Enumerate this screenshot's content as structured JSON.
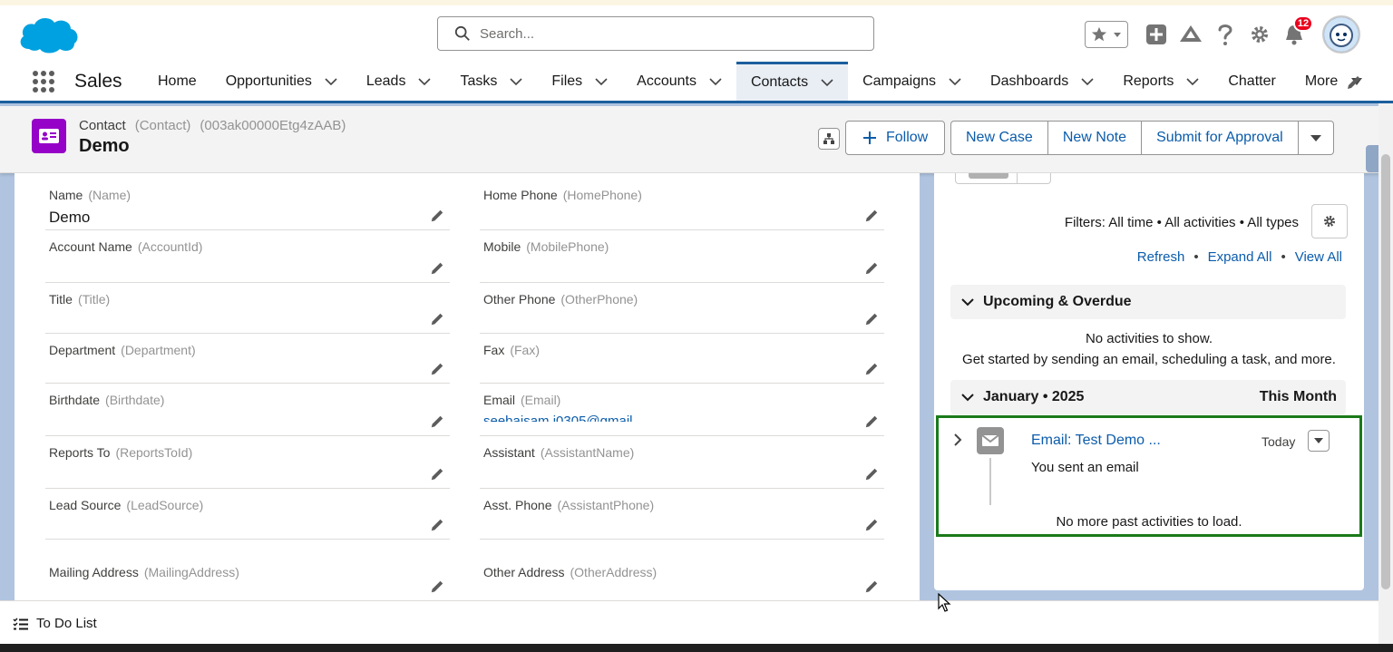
{
  "header": {
    "search_placeholder": "Search...",
    "notification_count": "12"
  },
  "nav": {
    "app_name": "Sales",
    "items": [
      {
        "label": "Home",
        "dropdown": false
      },
      {
        "label": "Opportunities",
        "dropdown": true
      },
      {
        "label": "Leads",
        "dropdown": true
      },
      {
        "label": "Tasks",
        "dropdown": true
      },
      {
        "label": "Files",
        "dropdown": true
      },
      {
        "label": "Accounts",
        "dropdown": true
      },
      {
        "label": "Contacts",
        "dropdown": true,
        "active": true
      },
      {
        "label": "Campaigns",
        "dropdown": true
      },
      {
        "label": "Dashboards",
        "dropdown": true
      },
      {
        "label": "Reports",
        "dropdown": true
      },
      {
        "label": "Chatter",
        "dropdown": false
      },
      {
        "label": "More",
        "dropdown": true
      }
    ]
  },
  "record": {
    "object_label": "Contact",
    "object_api": "(Contact)",
    "record_id": "(003ak00000Etg4zAAB)",
    "name": "Demo",
    "follow_label": "Follow",
    "actions": [
      "New Case",
      "New Note",
      "Submit for Approval"
    ]
  },
  "fields": {
    "left": [
      {
        "label": "Name",
        "api": "(Name)",
        "value": "Demo"
      },
      {
        "label": "Account Name",
        "api": "(AccountId)",
        "value": ""
      },
      {
        "label": "Title",
        "api": "(Title)",
        "value": ""
      },
      {
        "label": "Department",
        "api": "(Department)",
        "value": ""
      },
      {
        "label": "Birthdate",
        "api": "(Birthdate)",
        "value": ""
      },
      {
        "label": "Reports To",
        "api": "(ReportsToId)",
        "value": ""
      },
      {
        "label": "Lead Source",
        "api": "(LeadSource)",
        "value": ""
      },
      {
        "label": "Mailing Address",
        "api": "(MailingAddress)",
        "value": ""
      }
    ],
    "right": [
      {
        "label": "Home Phone",
        "api": "(HomePhone)",
        "value": ""
      },
      {
        "label": "Mobile",
        "api": "(MobilePhone)",
        "value": ""
      },
      {
        "label": "Other Phone",
        "api": "(OtherPhone)",
        "value": ""
      },
      {
        "label": "Fax",
        "api": "(Fax)",
        "value": ""
      },
      {
        "label": "Email",
        "api": "(Email)",
        "value": "seebaisam.i0305@gmail"
      },
      {
        "label": "Assistant",
        "api": "(AssistantName)",
        "value": ""
      },
      {
        "label": "Asst. Phone",
        "api": "(AssistantPhone)",
        "value": ""
      },
      {
        "label": "Other Address",
        "api": "(OtherAddress)",
        "value": ""
      }
    ]
  },
  "activity": {
    "filters": "Filters: All time • All activities • All types",
    "links": [
      "Refresh",
      "Expand All",
      "View All"
    ],
    "upcoming_header": "Upcoming & Overdue",
    "no_activities": "No activities to show.",
    "get_started": "Get started by sending an email, scheduling a task, and more.",
    "month_header": "January • 2025",
    "month_tag": "This Month",
    "item": {
      "title": "Email: Test Demo ...",
      "date": "Today",
      "subtitle": "You sent an email"
    },
    "no_more": "No more past activities to load."
  },
  "utility": {
    "todo_label": "To Do List"
  },
  "colors": {
    "brand_blue": "#0b5cab",
    "nav_active_border": "#1b5f9e",
    "contact_icon": "#9602c7",
    "highlight_border": "#1a7a1a",
    "notification_badge": "#ea001e"
  }
}
